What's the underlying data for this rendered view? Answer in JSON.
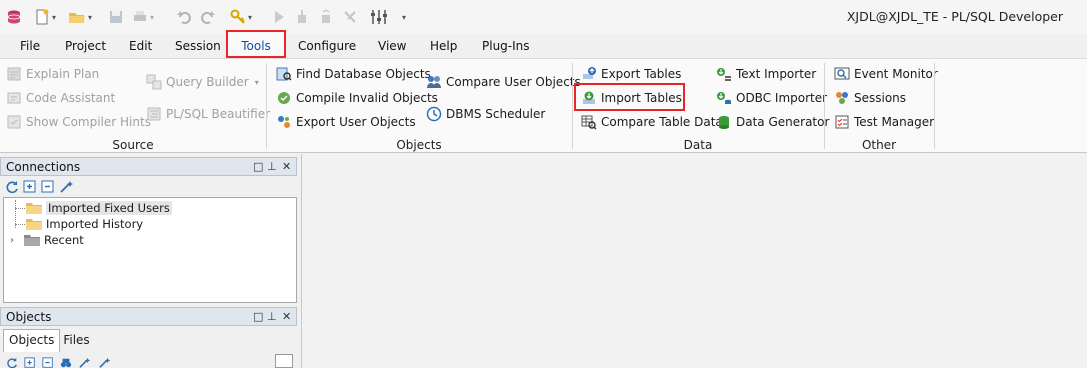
{
  "window": {
    "title": "XJDL@XJDL_TE - PL/SQL Developer"
  },
  "quick_access": [
    {
      "icon": "database-icon"
    },
    {
      "icon": "new-file-icon"
    },
    {
      "icon": "open-folder-icon"
    },
    {
      "icon": "save-icon"
    },
    {
      "icon": "print-icon"
    },
    {
      "icon": "undo-icon"
    },
    {
      "icon": "redo-icon"
    },
    {
      "icon": "key-icon"
    },
    {
      "icon": "run-icon"
    },
    {
      "icon": "step-icon"
    },
    {
      "icon": "commit-icon"
    },
    {
      "icon": "rollback-icon"
    },
    {
      "icon": "sliders-icon"
    },
    {
      "icon": "customize-caret-icon"
    }
  ],
  "menu": {
    "items": [
      "File",
      "Project",
      "Edit",
      "Session",
      "Tools",
      "Configure",
      "View",
      "Help",
      "Plug-Ins"
    ],
    "active": "Tools"
  },
  "ribbon": {
    "source": {
      "label": "Source",
      "explain_plan": "Explain Plan",
      "code_assistant": "Code Assistant",
      "show_compiler_hints": "Show Compiler Hints",
      "query_builder": "Query Builder",
      "plsql_beautifier": "PL/SQL Beautifier"
    },
    "objects": {
      "label": "Objects",
      "find_database_objects": "Find Database Objects",
      "compile_invalid_objects": "Compile Invalid Objects",
      "export_user_objects": "Export User Objects",
      "compare_user_objects": "Compare User Objects",
      "dbms_scheduler": "DBMS Scheduler"
    },
    "data": {
      "label": "Data",
      "export_tables": "Export Tables",
      "import_tables": "Import Tables",
      "compare_table_data": "Compare Table Data",
      "text_importer": "Text Importer",
      "odbc_importer": "ODBC Importer",
      "data_generator": "Data Generator"
    },
    "other": {
      "label": "Other",
      "event_monitor": "Event Monitor",
      "sessions": "Sessions",
      "test_manager": "Test Manager"
    }
  },
  "connections_panel": {
    "title": "Connections",
    "tree": [
      "Imported Fixed Users",
      "Imported History",
      "Recent"
    ]
  },
  "objects_panel": {
    "title": "Objects",
    "tabs": [
      "Objects",
      "Files"
    ]
  },
  "colors": {
    "highlight": "#e8262a",
    "active_menu_text": "#0f4fa3",
    "panel_header": "#dfe6ee"
  }
}
